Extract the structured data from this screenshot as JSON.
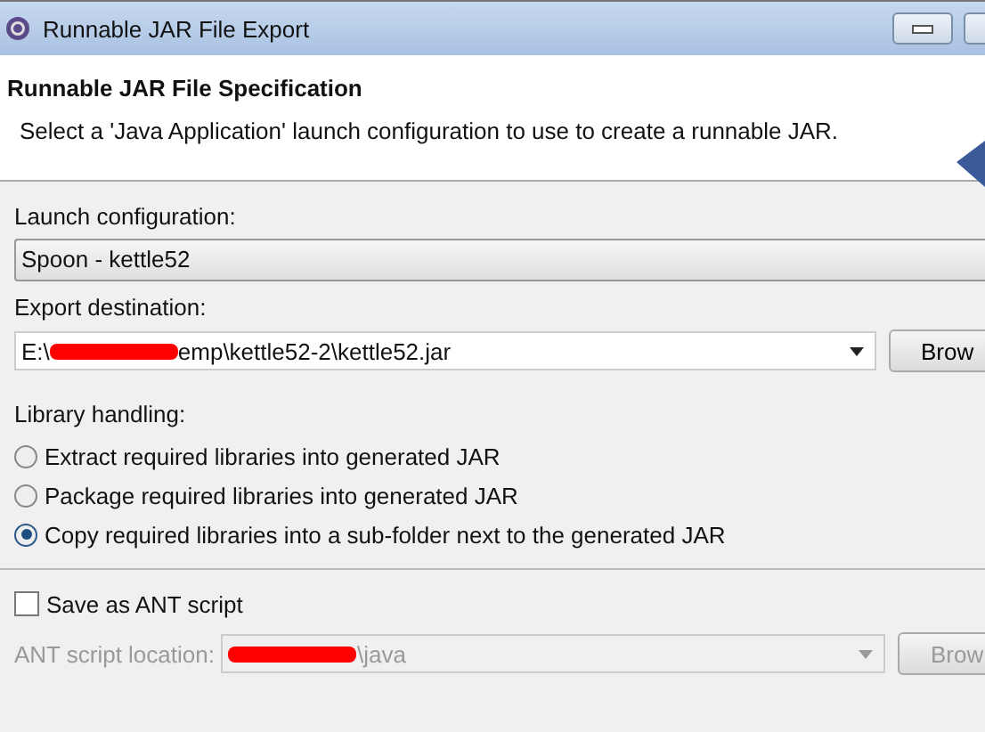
{
  "window": {
    "title": "Runnable JAR File Export"
  },
  "header": {
    "title": "Runnable JAR File Specification",
    "description": "Select a 'Java Application' launch configuration to use to create a runnable JAR."
  },
  "launch_configuration": {
    "label": "Launch configuration:",
    "value": "Spoon - kettle52"
  },
  "export_destination": {
    "label": "Export destination:",
    "value_prefix": "E:\\",
    "value_suffix": "emp\\kettle52-2\\kettle52.jar",
    "button": "Brow"
  },
  "library_handling": {
    "label": "Library handling:",
    "options": [
      {
        "label": "Extract required libraries into generated JAR",
        "selected": false
      },
      {
        "label": "Package required libraries into generated JAR",
        "selected": false
      },
      {
        "label": "Copy required libraries into a sub-folder next to the generated JAR",
        "selected": true
      }
    ]
  },
  "save_ant": {
    "label": "Save as ANT script",
    "checked": false
  },
  "ant_location": {
    "label": "ANT script location:",
    "value_suffix": "\\java",
    "button": "Brow",
    "disabled": true
  }
}
